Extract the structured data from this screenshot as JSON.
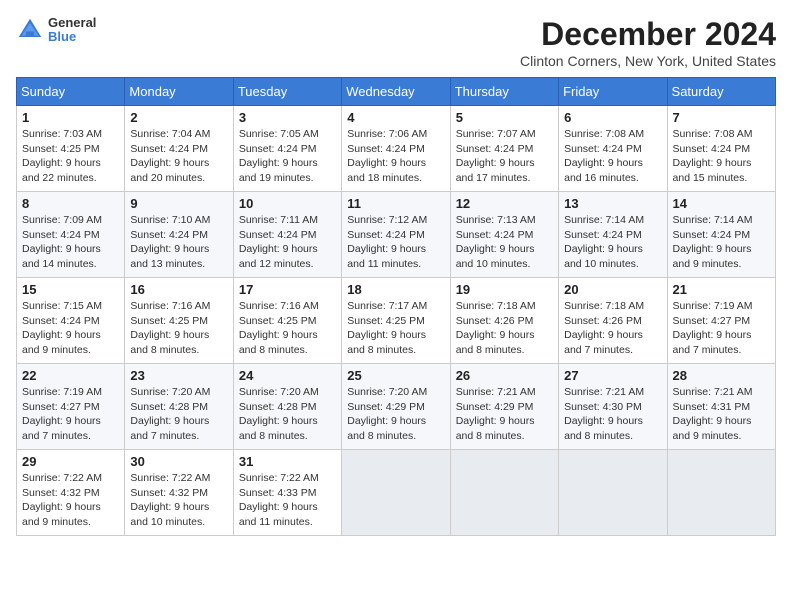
{
  "header": {
    "month_title": "December 2024",
    "location": "Clinton Corners, New York, United States",
    "logo_general": "General",
    "logo_blue": "Blue"
  },
  "weekdays": [
    "Sunday",
    "Monday",
    "Tuesday",
    "Wednesday",
    "Thursday",
    "Friday",
    "Saturday"
  ],
  "weeks": [
    [
      {
        "day": "1",
        "sunrise": "7:03 AM",
        "sunset": "4:25 PM",
        "daylight": "9 hours and 22 minutes."
      },
      {
        "day": "2",
        "sunrise": "7:04 AM",
        "sunset": "4:24 PM",
        "daylight": "9 hours and 20 minutes."
      },
      {
        "day": "3",
        "sunrise": "7:05 AM",
        "sunset": "4:24 PM",
        "daylight": "9 hours and 19 minutes."
      },
      {
        "day": "4",
        "sunrise": "7:06 AM",
        "sunset": "4:24 PM",
        "daylight": "9 hours and 18 minutes."
      },
      {
        "day": "5",
        "sunrise": "7:07 AM",
        "sunset": "4:24 PM",
        "daylight": "9 hours and 17 minutes."
      },
      {
        "day": "6",
        "sunrise": "7:08 AM",
        "sunset": "4:24 PM",
        "daylight": "9 hours and 16 minutes."
      },
      {
        "day": "7",
        "sunrise": "7:08 AM",
        "sunset": "4:24 PM",
        "daylight": "9 hours and 15 minutes."
      }
    ],
    [
      {
        "day": "8",
        "sunrise": "7:09 AM",
        "sunset": "4:24 PM",
        "daylight": "9 hours and 14 minutes."
      },
      {
        "day": "9",
        "sunrise": "7:10 AM",
        "sunset": "4:24 PM",
        "daylight": "9 hours and 13 minutes."
      },
      {
        "day": "10",
        "sunrise": "7:11 AM",
        "sunset": "4:24 PM",
        "daylight": "9 hours and 12 minutes."
      },
      {
        "day": "11",
        "sunrise": "7:12 AM",
        "sunset": "4:24 PM",
        "daylight": "9 hours and 11 minutes."
      },
      {
        "day": "12",
        "sunrise": "7:13 AM",
        "sunset": "4:24 PM",
        "daylight": "9 hours and 10 minutes."
      },
      {
        "day": "13",
        "sunrise": "7:14 AM",
        "sunset": "4:24 PM",
        "daylight": "9 hours and 10 minutes."
      },
      {
        "day": "14",
        "sunrise": "7:14 AM",
        "sunset": "4:24 PM",
        "daylight": "9 hours and 9 minutes."
      }
    ],
    [
      {
        "day": "15",
        "sunrise": "7:15 AM",
        "sunset": "4:24 PM",
        "daylight": "9 hours and 9 minutes."
      },
      {
        "day": "16",
        "sunrise": "7:16 AM",
        "sunset": "4:25 PM",
        "daylight": "9 hours and 8 minutes."
      },
      {
        "day": "17",
        "sunrise": "7:16 AM",
        "sunset": "4:25 PM",
        "daylight": "9 hours and 8 minutes."
      },
      {
        "day": "18",
        "sunrise": "7:17 AM",
        "sunset": "4:25 PM",
        "daylight": "9 hours and 8 minutes."
      },
      {
        "day": "19",
        "sunrise": "7:18 AM",
        "sunset": "4:26 PM",
        "daylight": "9 hours and 8 minutes."
      },
      {
        "day": "20",
        "sunrise": "7:18 AM",
        "sunset": "4:26 PM",
        "daylight": "9 hours and 7 minutes."
      },
      {
        "day": "21",
        "sunrise": "7:19 AM",
        "sunset": "4:27 PM",
        "daylight": "9 hours and 7 minutes."
      }
    ],
    [
      {
        "day": "22",
        "sunrise": "7:19 AM",
        "sunset": "4:27 PM",
        "daylight": "9 hours and 7 minutes."
      },
      {
        "day": "23",
        "sunrise": "7:20 AM",
        "sunset": "4:28 PM",
        "daylight": "9 hours and 7 minutes."
      },
      {
        "day": "24",
        "sunrise": "7:20 AM",
        "sunset": "4:28 PM",
        "daylight": "9 hours and 8 minutes."
      },
      {
        "day": "25",
        "sunrise": "7:20 AM",
        "sunset": "4:29 PM",
        "daylight": "9 hours and 8 minutes."
      },
      {
        "day": "26",
        "sunrise": "7:21 AM",
        "sunset": "4:29 PM",
        "daylight": "9 hours and 8 minutes."
      },
      {
        "day": "27",
        "sunrise": "7:21 AM",
        "sunset": "4:30 PM",
        "daylight": "9 hours and 8 minutes."
      },
      {
        "day": "28",
        "sunrise": "7:21 AM",
        "sunset": "4:31 PM",
        "daylight": "9 hours and 9 minutes."
      }
    ],
    [
      {
        "day": "29",
        "sunrise": "7:22 AM",
        "sunset": "4:32 PM",
        "daylight": "9 hours and 9 minutes."
      },
      {
        "day": "30",
        "sunrise": "7:22 AM",
        "sunset": "4:32 PM",
        "daylight": "9 hours and 10 minutes."
      },
      {
        "day": "31",
        "sunrise": "7:22 AM",
        "sunset": "4:33 PM",
        "daylight": "9 hours and 11 minutes."
      },
      null,
      null,
      null,
      null
    ]
  ]
}
